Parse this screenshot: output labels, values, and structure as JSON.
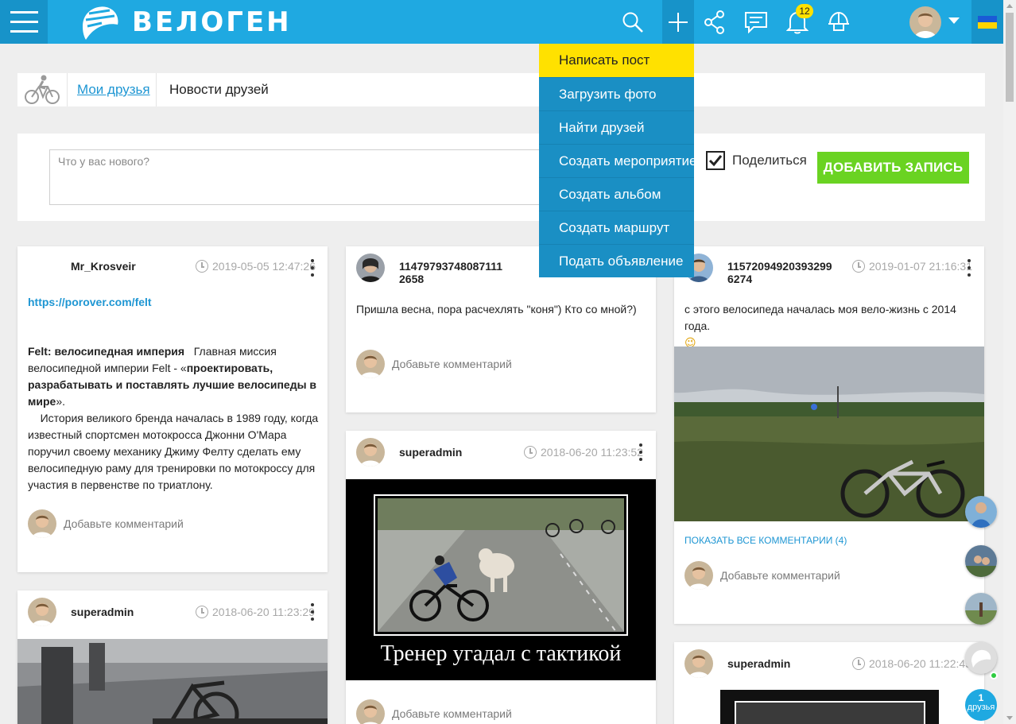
{
  "brand": {
    "logo_text": "ВЕЛОГЕН"
  },
  "topbar": {
    "icons": [
      "menu-icon",
      "search-icon",
      "plus-icon",
      "share-icon",
      "messages-icon",
      "bell-icon",
      "helmet-icon"
    ],
    "notifications_count": "12",
    "accent": "#1fa9e1"
  },
  "breadcrumb": {
    "link": "Мои друзья",
    "current": "Новости друзей"
  },
  "composer": {
    "placeholder": "Что у вас нового?",
    "share_label": "Поделиться",
    "add_button": "ДОБАВИТЬ ЗАПИСЬ"
  },
  "dropdown": {
    "items": [
      "Написать пост",
      "Загрузить фото",
      "Найти друзей",
      "Создать мероприятие",
      "Создать альбом",
      "Создать маршрут",
      "Подать объявление"
    ],
    "highlighted": "Написать пост"
  },
  "comment_placeholder": "Добавьте комментарий",
  "posts": [
    {
      "author": "Mr_Krosveir",
      "time": "2019-05-05 12:47:26",
      "link": "https://porover.com/felt",
      "title": "Felt: велосипедная империя",
      "body_1": "Главная миссия велосипедной империи Felt - «",
      "body_bold": "проектировать, разрабатывать и поставлять лучшие велосипеды в мире",
      "body_2": "».",
      "body_3": "История великого бренда началась в 1989 году, когда известный спортсмен мотокросса Джонни О'Мара поручил своему механику Джиму Фелту сделать ему велосипедную раму для тренировки по мотокроссу для участия в первенстве по триатлону."
    },
    {
      "author_line1": "11479793748087111",
      "author_line2": "2658",
      "text": "Пришла весна, пора расчехлять \"коня\") Кто со мной?)"
    },
    {
      "author_line1": "11572094920393299",
      "author_line2": "6274",
      "time": "2019-01-07 21:16:31",
      "text": "с этого велосипеда началась моя вело-жизнь с 2014 года.",
      "emoji": "😉",
      "show_all": "ПОКАЗАТЬ ВСЕ КОММЕНТАРИИ (4)"
    },
    {
      "author": "superadmin",
      "time": "2018-06-20 11:23:52",
      "image_caption": "Тренер угадал с тактикой"
    },
    {
      "author": "superadmin",
      "time": "2018-06-20 11:23:29"
    },
    {
      "author": "superadmin",
      "time": "2018-06-20 11:22:45"
    }
  ],
  "rail": {
    "friends_count": "1",
    "friends_label": "друзья"
  }
}
